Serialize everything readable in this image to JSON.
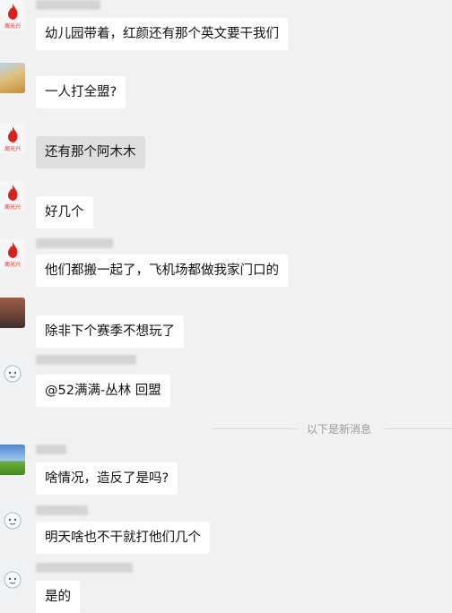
{
  "messages": [
    {
      "avatar": "fire-logo-avatar",
      "avatar_text": "周光兴",
      "text": "幼儿园带着，红颜还有那个英文要干我们"
    },
    {
      "avatar": "wheat-field-avatar",
      "text": "一人打全盟?"
    },
    {
      "avatar": "fire-logo-avatar",
      "avatar_text": "周光兴",
      "text": "还有那个阿木木"
    },
    {
      "avatar": "fire-logo-avatar",
      "avatar_text": "周光兴",
      "text": "好几个"
    },
    {
      "avatar": "fire-logo-avatar",
      "avatar_text": "周光兴",
      "text": "他们都搬一起了，飞机场都做我家门口的"
    },
    {
      "avatar": "sunset-avatar",
      "text": "除非下个赛季不想玩了"
    },
    {
      "avatar": "cartoon-avatar",
      "text": "@52满满-丛林 回盟"
    },
    {
      "avatar": "grass-sky-avatar",
      "text": "啥情况，造反了是吗?"
    },
    {
      "avatar": "cartoon-avatar",
      "text": "明天啥也不干就打他们几个"
    },
    {
      "avatar": "cartoon-avatar",
      "text": "是的"
    }
  ],
  "divider": {
    "text": "以下是新消息"
  },
  "colors": {
    "background": "#f1f1f1",
    "bubble": "#ffffff",
    "bubble_selected": "#dedede",
    "fire_red": "#d6231e"
  }
}
